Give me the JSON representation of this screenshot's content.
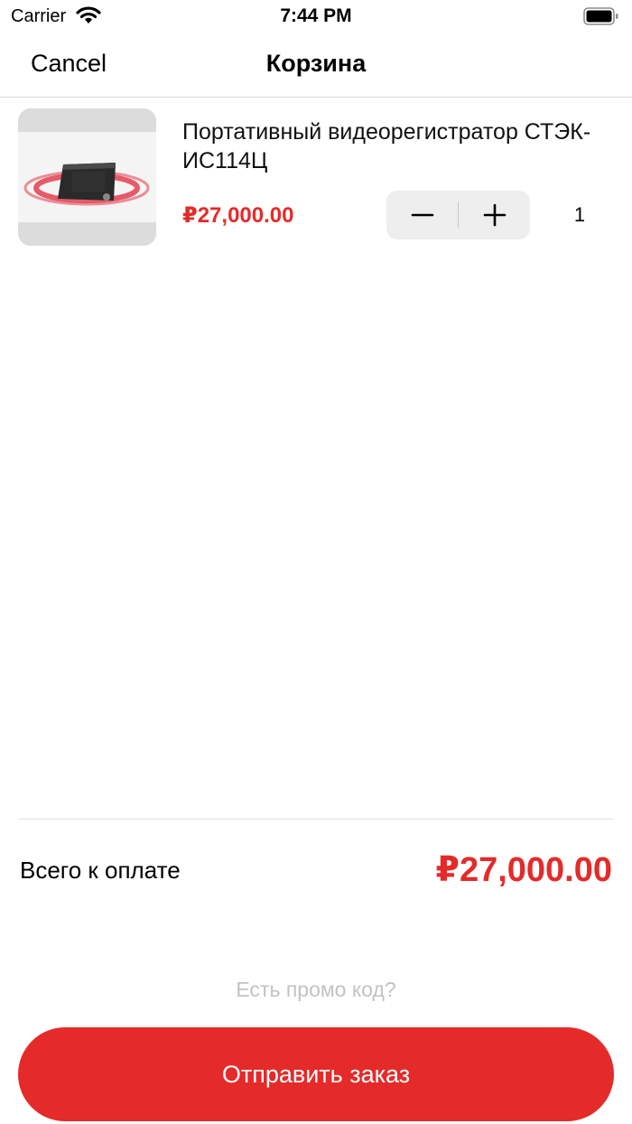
{
  "status_bar": {
    "carrier": "Carrier",
    "time": "7:44 PM",
    "icons": [
      "wifi-icon",
      "battery-icon"
    ]
  },
  "nav": {
    "cancel_label": "Cancel",
    "title": "Корзина"
  },
  "cart": {
    "items": [
      {
        "name": "Портативный видеорегистратор СТЭК-ИС114Ц",
        "price": "₽27,000.00",
        "quantity": "1",
        "image": "product-photo-video-recorder"
      }
    ]
  },
  "stepper": {
    "icons": [
      "minus-icon",
      "plus-icon"
    ]
  },
  "summary": {
    "total_label": "Всего к оплате",
    "total_value": "₽27,000.00"
  },
  "promo": {
    "label": "Есть промо код?"
  },
  "submit": {
    "label": "Отправить заказ"
  },
  "colors": {
    "accent": "#e52a2a",
    "stepper_bg": "#eeeeef",
    "promo_text": "#c2c2c2",
    "separator": "#d9d9d9"
  }
}
